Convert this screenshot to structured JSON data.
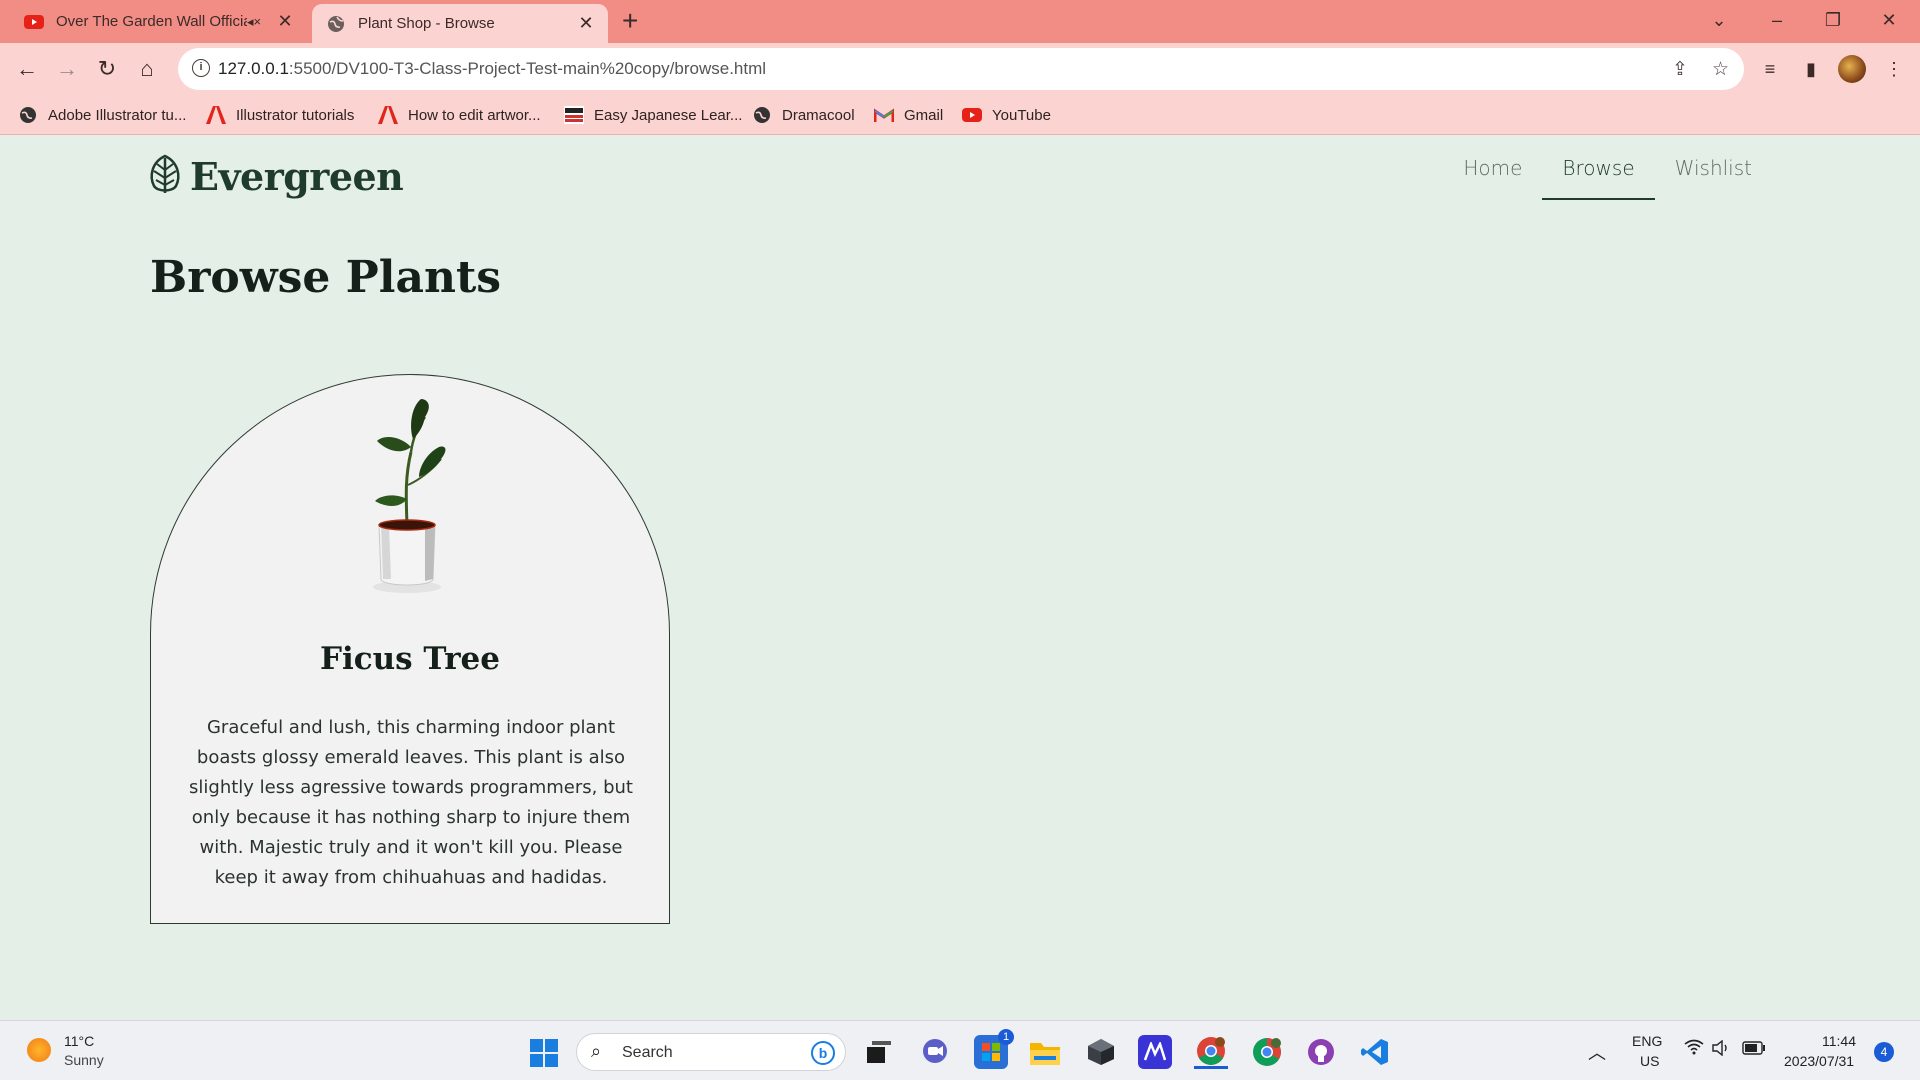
{
  "browser": {
    "tabs": [
      {
        "title": "Over The Garden Wall Officia",
        "favicon": "youtube-icon",
        "audio": "speaker-muted-icon"
      },
      {
        "title": "Plant Shop - Browse",
        "favicon": "globe-icon"
      }
    ],
    "url_host": "127.0.0.1",
    "url_path": ":5500/DV100-T3-Class-Project-Test-main%20copy/browse.html",
    "bookmarks": [
      {
        "label": "Adobe Illustrator tu...",
        "icon": "globe-icon"
      },
      {
        "label": "Illustrator tutorials",
        "icon": "adobe-icon"
      },
      {
        "label": "How to edit artwor...",
        "icon": "adobe-icon"
      },
      {
        "label": "Easy Japanese Lear...",
        "icon": "nhk-icon"
      },
      {
        "label": "Dramacool",
        "icon": "globe-icon"
      },
      {
        "label": "Gmail",
        "icon": "gmail-icon"
      },
      {
        "label": "YouTube",
        "icon": "youtube-icon"
      }
    ],
    "colors": {
      "tabbar": "#f28d86",
      "toolbar": "#fbd3d1"
    }
  },
  "site": {
    "brand": "Evergreen",
    "nav": [
      "Home",
      "Browse",
      "Wishlist"
    ],
    "active_nav": "Browse",
    "page_title": "Browse Plants",
    "products": [
      {
        "name": "Ficus Tree",
        "description": "Graceful and lush, this charming indoor plant boasts glossy emerald leaves. This plant is also slightly less agressive towards programmers, but only because it has nothing sharp to injure them with. Majestic truly and it won't kill you. Please keep it away from chihuahuas and hadidas."
      }
    ],
    "colors": {
      "background": "#e4efe7",
      "card": "#f2f2f2",
      "brand": "#1f3b2b"
    }
  },
  "taskbar": {
    "weather_temp": "11°C",
    "weather_desc": "Sunny",
    "search_placeholder": "Search",
    "store_badge": "1",
    "lang_top": "ENG",
    "lang_bottom": "US",
    "time": "11:44",
    "date": "2023/07/31",
    "notifications": "4"
  }
}
